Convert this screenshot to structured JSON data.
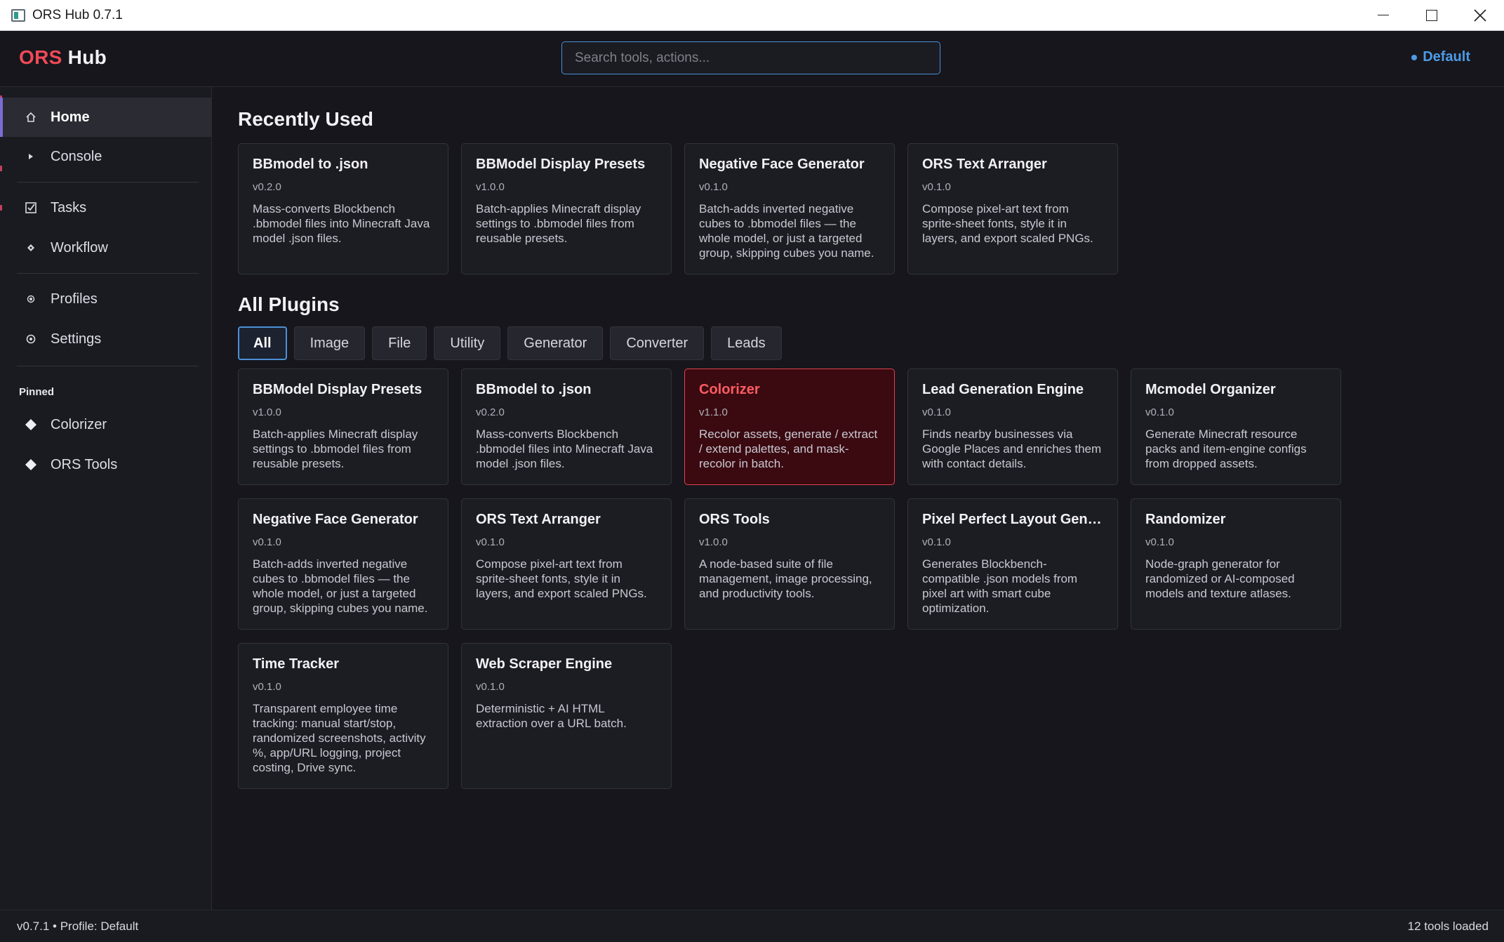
{
  "window": {
    "title": "ORS Hub 0.7.1",
    "controls": [
      "minimize",
      "maximize",
      "close"
    ]
  },
  "header": {
    "brand_part1": "ORS",
    "brand_part2": "Hub",
    "search_placeholder": "Search tools, actions...",
    "profile_label": "Default"
  },
  "sidebar": {
    "items": [
      {
        "label": "Home",
        "icon": "home-icon",
        "active": true
      },
      {
        "label": "Console",
        "icon": "play-icon"
      },
      {
        "label": "Tasks",
        "icon": "checkbox-icon"
      },
      {
        "label": "Workflow",
        "icon": "node-icon"
      },
      {
        "label": "Profiles",
        "icon": "profile-icon"
      },
      {
        "label": "Settings",
        "icon": "gear-icon"
      }
    ],
    "pinned_label": "Pinned",
    "pinned": [
      {
        "label": "Colorizer",
        "icon": "diamond-icon"
      },
      {
        "label": "ORS Tools",
        "icon": "diamond-icon"
      }
    ]
  },
  "recent": {
    "title": "Recently Used",
    "cards": [
      {
        "title": "BBmodel to .json",
        "version": "v0.2.0",
        "desc": "Mass-converts Blockbench .bbmodel files into Minecraft Java model .json files."
      },
      {
        "title": "BBModel Display Presets",
        "version": "v1.0.0",
        "desc": "Batch-applies Minecraft display settings to .bbmodel files from reusable presets."
      },
      {
        "title": "Negative Face Generator",
        "version": "v0.1.0",
        "desc": "Batch-adds inverted negative cubes to .bbmodel files — the whole model, or just a targeted group, skipping cubes you name."
      },
      {
        "title": "ORS Text Arranger",
        "version": "v0.1.0",
        "desc": "Compose pixel-art text from sprite-sheet fonts, style it in layers, and export scaled PNGs."
      }
    ]
  },
  "plugins": {
    "title": "All Plugins",
    "filters": [
      "All",
      "Image",
      "File",
      "Utility",
      "Generator",
      "Converter",
      "Leads"
    ],
    "active_filter": "All",
    "cards": [
      {
        "title": "BBModel Display Presets",
        "version": "v1.0.0",
        "desc": "Batch-applies Minecraft display settings to .bbmodel files from reusable presets."
      },
      {
        "title": "BBmodel to .json",
        "version": "v0.2.0",
        "desc": "Mass-converts Blockbench .bbmodel files into Minecraft Java model .json files."
      },
      {
        "title": "Colorizer",
        "version": "v1.1.0",
        "desc": "Recolor assets, generate / extract / extend palettes, and mask-recolor in batch.",
        "highlighted": true
      },
      {
        "title": "Lead Generation Engine",
        "version": "v0.1.0",
        "desc": "Finds nearby businesses via Google Places and enriches them with contact details."
      },
      {
        "title": "Mcmodel Organizer",
        "version": "v0.1.0",
        "desc": "Generate Minecraft resource packs and item-engine configs from dropped assets."
      },
      {
        "title": "Negative Face Generator",
        "version": "v0.1.0",
        "desc": "Batch-adds inverted negative cubes to .bbmodel files — the whole model, or just a targeted group, skipping cubes you name."
      },
      {
        "title": "ORS Text Arranger",
        "version": "v0.1.0",
        "desc": "Compose pixel-art text from sprite-sheet fonts, style it in layers, and export scaled PNGs."
      },
      {
        "title": "ORS Tools",
        "version": "v1.0.0",
        "desc": "A node-based suite of file management, image processing, and productivity tools."
      },
      {
        "title": "Pixel Perfect Layout Gene...",
        "version": "v0.1.0",
        "desc": "Generates Blockbench-compatible .json models from pixel art with smart cube optimization."
      },
      {
        "title": "Randomizer",
        "version": "v0.1.0",
        "desc": "Node-graph generator for randomized or AI-composed models and texture atlases."
      },
      {
        "title": "Time Tracker",
        "version": "v0.1.0",
        "desc": "Transparent employee time tracking: manual start/stop, randomized screenshots, activity %, app/URL logging, project costing, Drive sync."
      },
      {
        "title": "Web Scraper Engine",
        "version": "v0.1.0",
        "desc": "Deterministic + AI HTML extraction over a URL batch."
      }
    ]
  },
  "status": {
    "left": "v0.7.1  •  Profile: Default",
    "right": "12 tools loaded"
  },
  "colors": {
    "accent_blue": "#4d8fd6",
    "brand_red": "#f04a57",
    "highlight_bg": "#3a0a10",
    "highlight_border": "#e0424e"
  }
}
